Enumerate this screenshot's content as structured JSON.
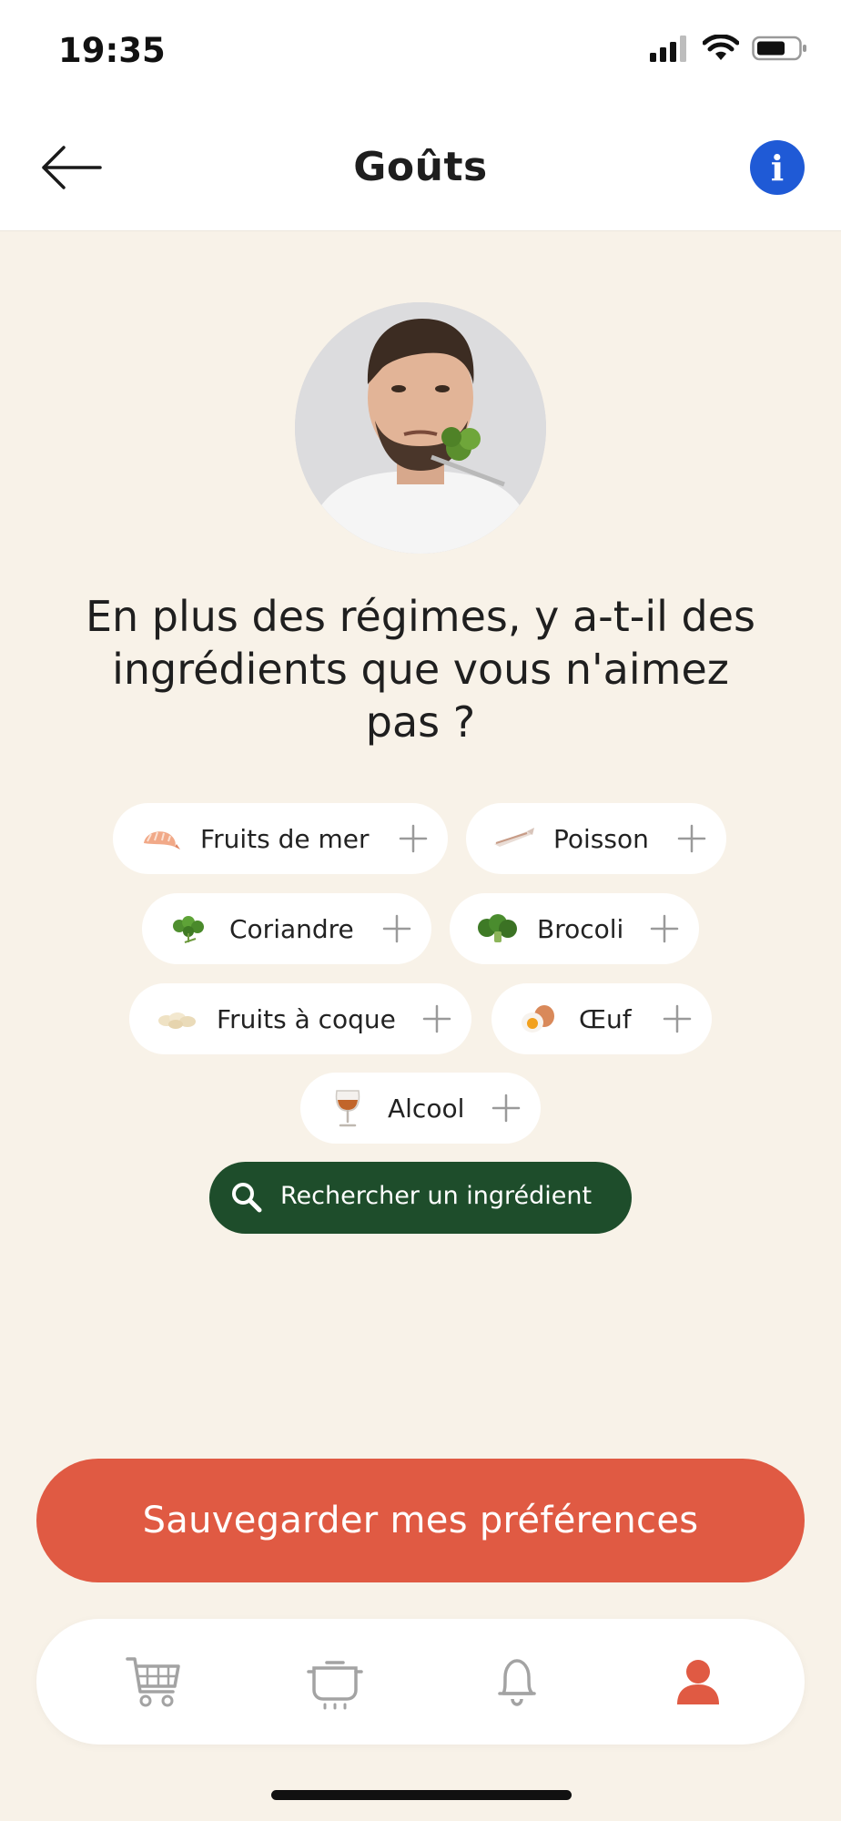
{
  "status_bar": {
    "time": "19:35"
  },
  "header": {
    "title": "Goûts",
    "back_icon": "arrow-left-icon",
    "info_label": "i"
  },
  "avatar": {
    "description_icon": "person-avatar"
  },
  "question": {
    "text": "En plus des régimes, y a-t-il des ingrédients que vous n'aimez pas ?"
  },
  "ingredients": [
    {
      "label": "Fruits de mer",
      "icon": "shrimp-icon"
    },
    {
      "label": "Poisson",
      "icon": "fish-icon"
    },
    {
      "label": "Coriandre",
      "icon": "coriander-icon"
    },
    {
      "label": "Brocoli",
      "icon": "broccoli-icon"
    },
    {
      "label": "Fruits à coque",
      "icon": "nuts-icon"
    },
    {
      "label": "Œuf",
      "icon": "egg-icon"
    },
    {
      "label": "Alcool",
      "icon": "wine-glass-icon"
    }
  ],
  "search": {
    "label": "Rechercher un ingrédient"
  },
  "save": {
    "label": "Sauvegarder mes préférences"
  },
  "tab_bar": {
    "items": [
      {
        "icon": "cart-icon",
        "active": false
      },
      {
        "icon": "cooking-pot-icon",
        "active": false
      },
      {
        "icon": "bell-icon",
        "active": false
      },
      {
        "icon": "profile-icon",
        "active": true
      }
    ]
  },
  "colors": {
    "background": "#f8f2e8",
    "accent": "#e05a43",
    "search_button": "#1e4d2b",
    "info": "#1f5ad6"
  }
}
